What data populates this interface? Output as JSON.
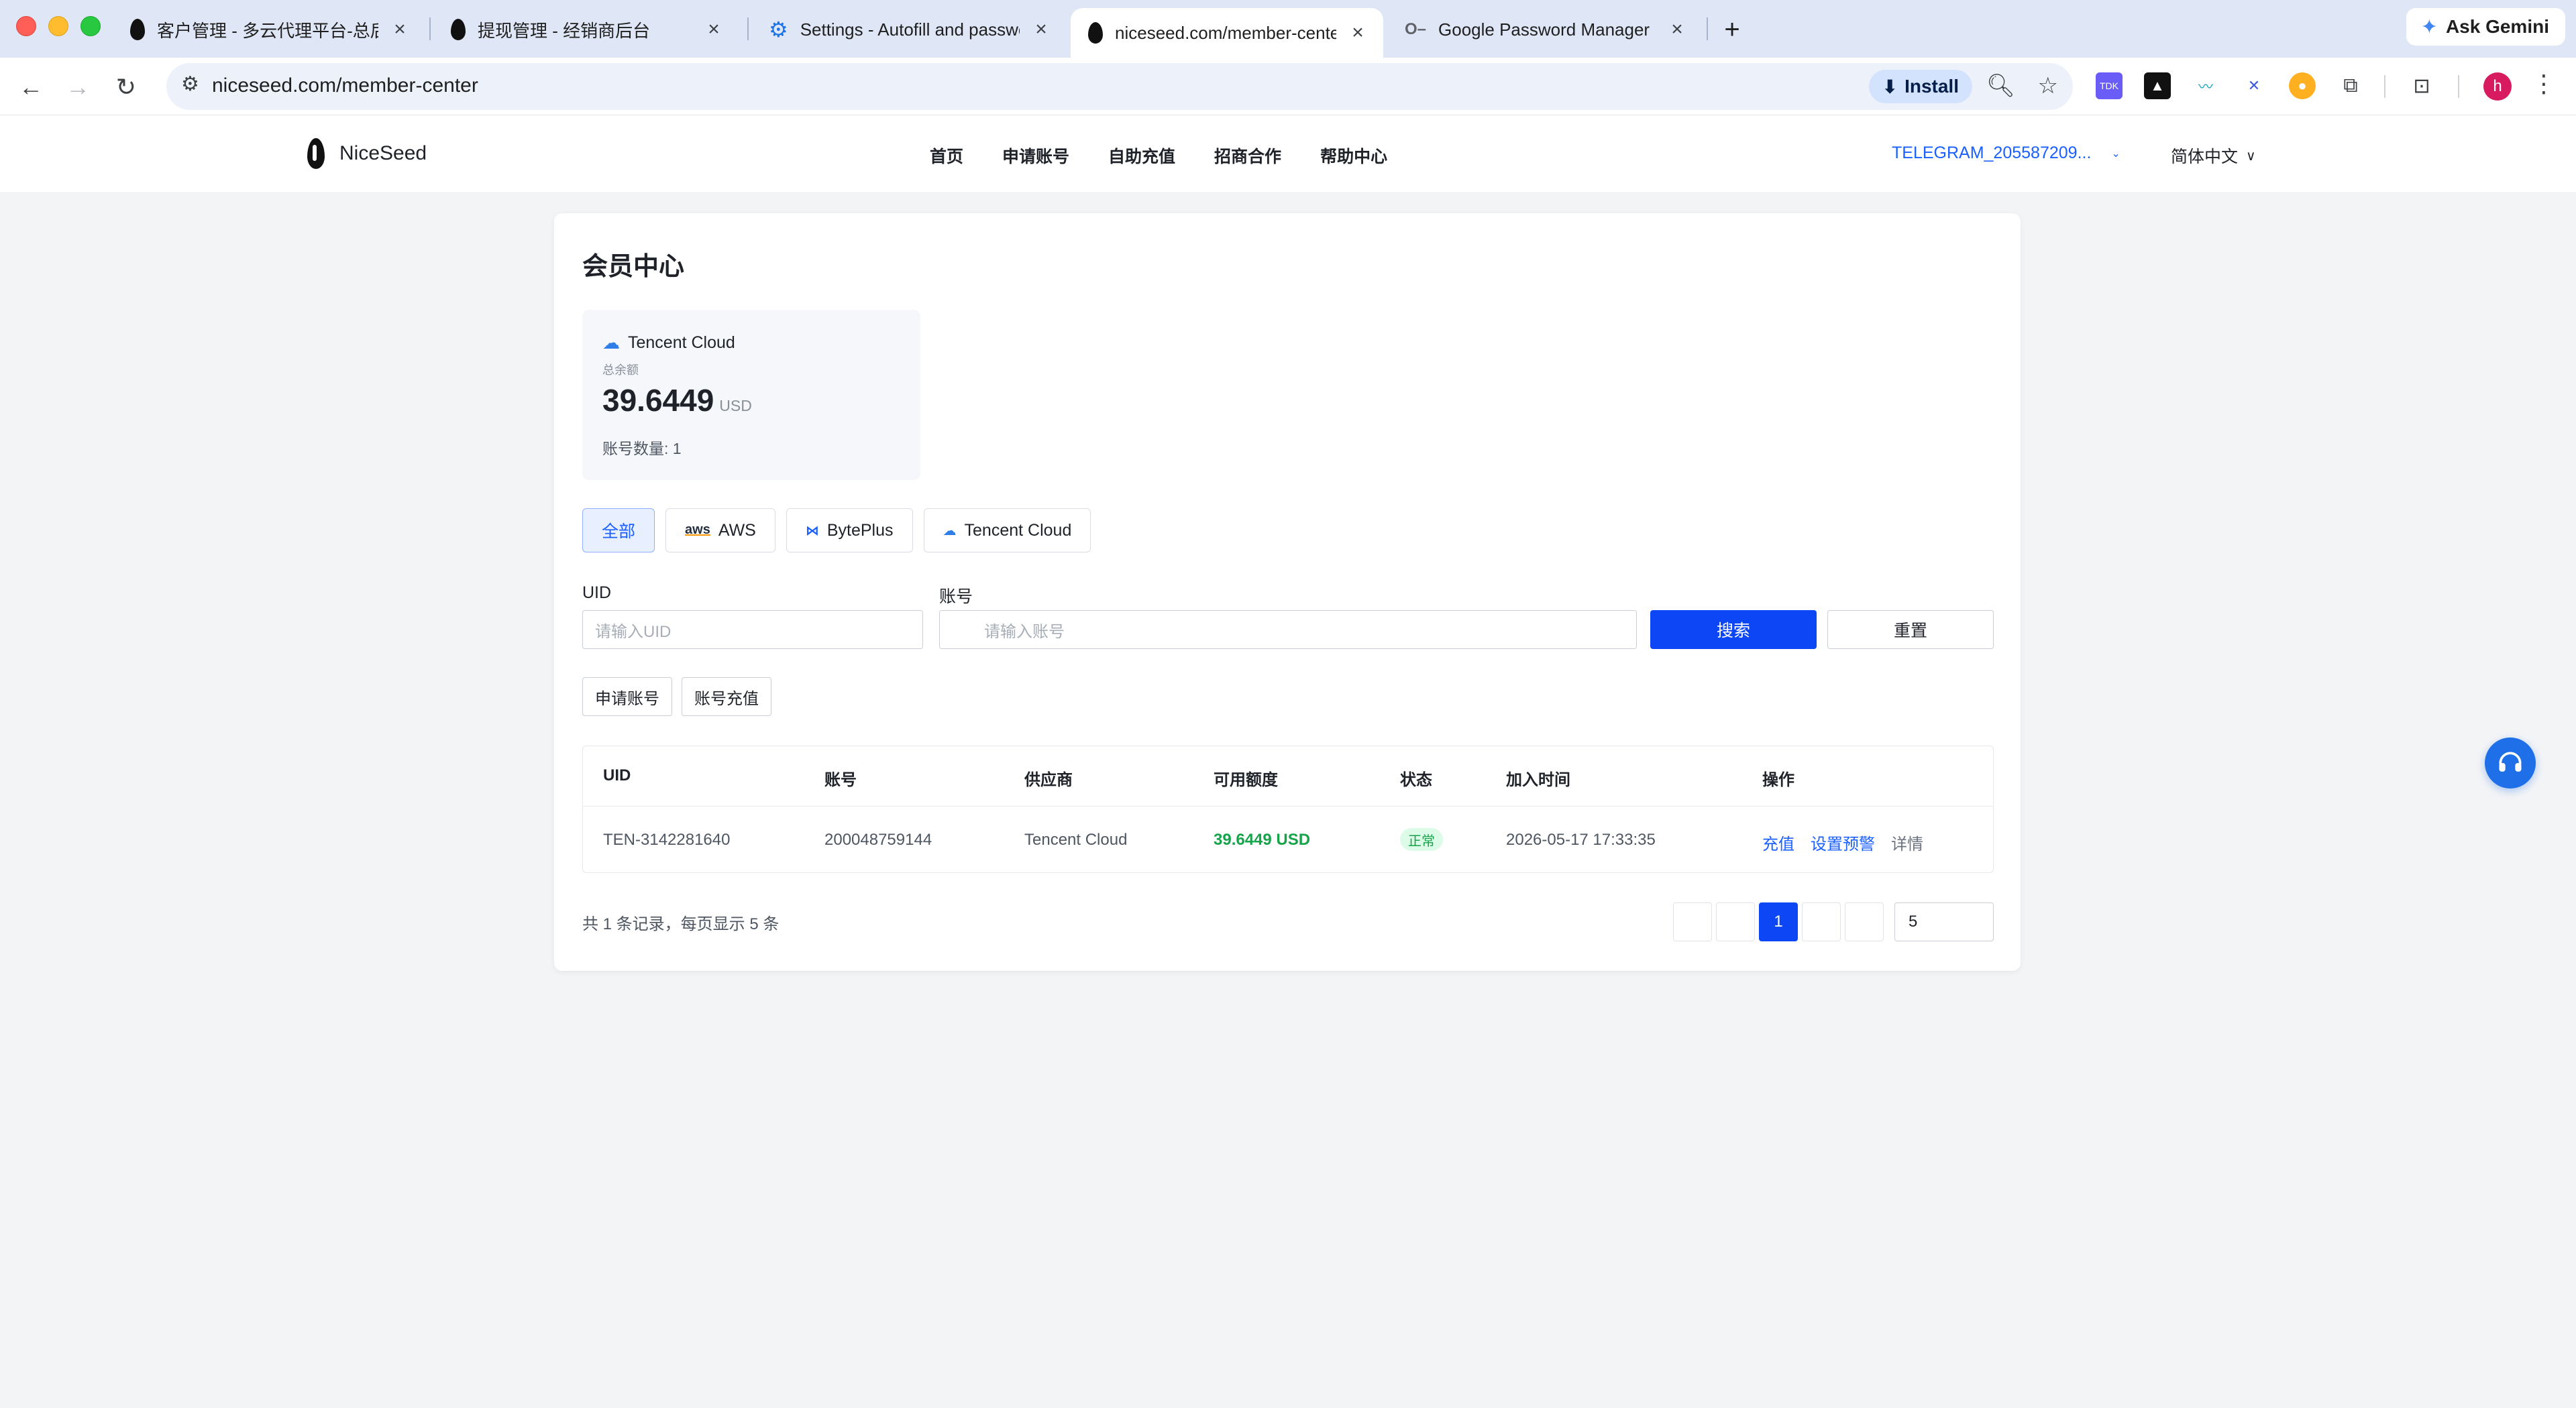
{
  "browser": {
    "tabs": [
      {
        "title": "客户管理 - 多云代理平台-总后台",
        "favicon": "seed-icon"
      },
      {
        "title": "提现管理 - 经销商后台",
        "favicon": "seed-icon"
      },
      {
        "title": "Settings - Autofill and passwords",
        "favicon": "gear-icon"
      },
      {
        "title": "niceseed.com/member-center",
        "favicon": "seed-icon",
        "active": true
      },
      {
        "title": "Google Password Manager",
        "favicon": "key-icon"
      }
    ],
    "new_tab_label": "+",
    "ask_gemini": "Ask Gemini",
    "url": "niceseed.com/member-center",
    "install_label": "Install",
    "profile_initial": "h"
  },
  "site": {
    "brand": "NiceSeed",
    "nav": [
      "首页",
      "申请账号",
      "自助充值",
      "招商合作",
      "帮助中心"
    ],
    "user": "TELEGRAM_205587209...",
    "language": "简体中文"
  },
  "page": {
    "title": "会员中心",
    "balance_card": {
      "provider": "Tencent Cloud",
      "label": "总余额",
      "amount": "39.6449",
      "unit": "USD",
      "count": "账号数量: 1"
    },
    "filter_tabs": [
      "全部",
      "AWS",
      "BytePlus",
      "Tencent Cloud"
    ],
    "search": {
      "uid_label": "UID",
      "uid_placeholder": "请输入UID",
      "account_label": "账号",
      "account_placeholder": "请输入账号",
      "search_button": "搜索",
      "reset_button": "重置"
    },
    "actions": {
      "apply": "申请账号",
      "recharge": "账号充值"
    },
    "table": {
      "headers": [
        "UID",
        "账号",
        "供应商",
        "可用额度",
        "状态",
        "加入时间",
        "操作"
      ],
      "rows": [
        {
          "uid": "TEN-3142281640",
          "account": "200048759144",
          "provider": "Tencent Cloud",
          "balance": "39.6449 USD",
          "status": "正常",
          "joined": "2026-05-17 17:33:35",
          "ops": [
            "充值",
            "设置预警",
            "详情"
          ]
        }
      ]
    },
    "pagination": {
      "summary": "共 1 条记录，每页显示 5 条",
      "current_page": "1",
      "page_size": "5"
    }
  },
  "colors": {
    "primary": "#0d47f5",
    "link": "#1a5fff",
    "success": "#16a34a",
    "success_bg": "#dcfce7",
    "page_bg": "#f3f4f6"
  }
}
